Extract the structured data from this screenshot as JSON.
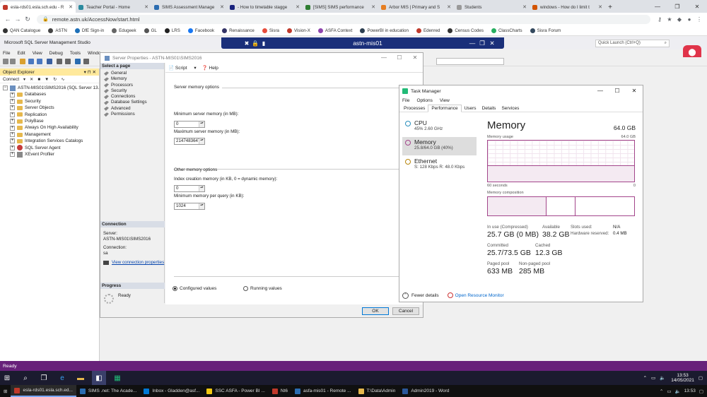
{
  "browser": {
    "tabs": [
      {
        "label": "esla-rds01.esla.sch.edu - R",
        "color": "#c0392b",
        "active": true
      },
      {
        "label": "Teacher Portal - Home",
        "color": "#2b8a9e"
      },
      {
        "label": "SIMS Assessment Manage",
        "color": "#2b6cb0"
      },
      {
        "label": "- How to timetable stagge",
        "color": "#1a237e"
      },
      {
        "label": "[SIMS] SIMS performance",
        "color": "#2e7d32"
      },
      {
        "label": "Arbor MIS | Primary and S",
        "color": "#e67e22"
      },
      {
        "label": "Students",
        "color": "#999999"
      },
      {
        "label": "windows - How do I limit t",
        "color": "#d35400"
      }
    ],
    "url": "remote.astn.uk/AccessNow/start.html",
    "bookmarks": [
      {
        "label": "QAN Catalogue",
        "color": "#333333"
      },
      {
        "label": "ASTN",
        "color": "#444444"
      },
      {
        "label": "DfE Sign-in",
        "color": "#1d70b8"
      },
      {
        "label": "Edugeek",
        "color": "#666666"
      },
      {
        "label": "GL",
        "color": "#555555"
      },
      {
        "label": "LRS",
        "color": "#222222"
      },
      {
        "label": "Facebook",
        "color": "#1877f2"
      },
      {
        "label": "Renaissance",
        "color": "#333366"
      },
      {
        "label": "Sisra",
        "color": "#e74c3c"
      },
      {
        "label": "Vision-X",
        "color": "#c0392b"
      },
      {
        "label": "ASFA Context",
        "color": "#8e44ad"
      },
      {
        "label": "PowerBI in education",
        "color": "#2c3e50"
      },
      {
        "label": "Edenred",
        "color": "#c0392b"
      },
      {
        "label": "Census Codes",
        "color": "#333333"
      },
      {
        "label": "ClassCharts",
        "color": "#27ae60"
      },
      {
        "label": "Sisra Forum",
        "color": "#34495e"
      }
    ]
  },
  "ssms": {
    "title": "Microsoft SQL Server Management Studio",
    "remote_name": "astn-mis01",
    "quick_launch": "Quick Launch (Ctrl+Q)",
    "menu": [
      "File",
      "Edit",
      "View",
      "Debug",
      "Tools",
      "Windo"
    ],
    "status": "Ready",
    "object_explorer": {
      "title": "Object Explorer",
      "connect_label": "Connect",
      "server_node": "ASTN-MIS01\\SIMS2016 (SQL Server 13.",
      "nodes": [
        {
          "label": "Databases",
          "icon": "folder"
        },
        {
          "label": "Security",
          "icon": "folder"
        },
        {
          "label": "Server Objects",
          "icon": "folder"
        },
        {
          "label": "Replication",
          "icon": "folder"
        },
        {
          "label": "PolyBase",
          "icon": "folder"
        },
        {
          "label": "Always On High Availability",
          "icon": "folder"
        },
        {
          "label": "Management",
          "icon": "folder"
        },
        {
          "label": "Integration Services Catalogs",
          "icon": "folder"
        },
        {
          "label": "SQL Server Agent",
          "icon": "agent"
        },
        {
          "label": "XEvent Profiler",
          "icon": "xe"
        }
      ]
    }
  },
  "server_props": {
    "title": "Server Properties - ASTN-MIS01\\SIMS2016",
    "select_page": "Select a page",
    "pages": [
      "General",
      "Memory",
      "Processors",
      "Security",
      "Connections",
      "Database Settings",
      "Advanced",
      "Permissions"
    ],
    "connection_head": "Connection",
    "server_label": "Server:",
    "server_value": "ASTN-MIS01\\SIMS2016",
    "connection_label": "Connection:",
    "connection_value": "sa",
    "view_conn_props": "View connection properties",
    "progress_head": "Progress",
    "progress_status": "Ready",
    "script_label": "Script",
    "help_label": "Help",
    "server_memory_options": "Server memory options",
    "min_mem_label": "Minimum server memory (in MB):",
    "min_mem_value": "0",
    "max_mem_label": "Maximum server memory (in MB):",
    "max_mem_value": "2147483647",
    "other_memory_options": "Other memory options",
    "index_mem_label": "Index creation memory (in KB, 0 = dynamic memory):",
    "index_mem_value": "0",
    "min_query_label": "Minimum memory per query (in KB):",
    "min_query_value": "1024",
    "configured_values": "Configured values",
    "running_values": "Running values",
    "ok_label": "OK",
    "cancel_label": "Cancel"
  },
  "task_manager": {
    "title": "Task Manager",
    "menu": [
      "File",
      "Options",
      "View"
    ],
    "tabs": [
      "Processes",
      "Performance",
      "Users",
      "Details",
      "Services"
    ],
    "active_tab": "Performance",
    "sidebar": [
      {
        "name": "CPU",
        "sub": "45%  2.60 GHz",
        "color": "#2a8fbd"
      },
      {
        "name": "Memory",
        "sub": "25.8/64.0 GB (40%)",
        "color": "#a3458b",
        "selected": true
      },
      {
        "name": "Ethernet",
        "sub": "S: 128 Kbps  R: 48.0 Kbps",
        "color": "#b8860b"
      }
    ],
    "heading": "Memory",
    "total": "64.0 GB",
    "usage_label": "Memory usage",
    "usage_max": "64.0 GB",
    "time_left": "60 seconds",
    "time_right": "0",
    "usage_fraction": 0.4,
    "composition_label": "Memory composition",
    "composition": [
      0.4,
      0.2,
      0.4
    ],
    "stats": {
      "in_use_label": "In use (Compressed)",
      "in_use_value": "25.7 GB (0 MB)",
      "available_label": "Available",
      "available_value": "38.2 GB",
      "committed_label": "Committed",
      "committed_value": "25.7/73.5 GB",
      "cached_label": "Cached",
      "cached_value": "12.3 GB",
      "paged_label": "Paged pool",
      "paged_value": "633 MB",
      "nonpaged_label": "Non-paged pool",
      "nonpaged_value": "285 MB",
      "slots_label": "Slots used:",
      "slots_value": "N/A",
      "reserved_label": "Hardware reserved:",
      "reserved_value": "0.4 MB"
    },
    "fewer_details": "Fewer details",
    "open_resmon": "Open Resource Monitor"
  },
  "remote_taskbar": {
    "time": "13:53",
    "date": "14/05/2021"
  },
  "local_taskbar": {
    "items": [
      {
        "label": "esla-rds01.esla.sch.ed...",
        "color": "#c0392b",
        "active": true
      },
      {
        "label": "SIMS .net: The Acade...",
        "color": "#2b6cb0"
      },
      {
        "label": "Inbox - Gladden@asf...",
        "color": "#0078d4"
      },
      {
        "label": "SSC ASFA - Power BI ...",
        "color": "#f2c811"
      },
      {
        "label": "Nt6",
        "color": "#c0392b"
      },
      {
        "label": "asfa-mis01 - Remote ...",
        "color": "#2b6cb0"
      },
      {
        "label": "T:\\Data\\Admin",
        "color": "#e6b84d"
      },
      {
        "label": "Admin2019 - Word",
        "color": "#2b579a"
      }
    ],
    "time": "13:53"
  }
}
